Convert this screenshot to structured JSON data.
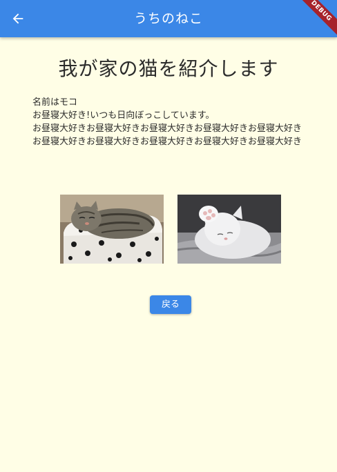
{
  "app_bar": {
    "title": "うちのねこ",
    "back_icon": "arrow-left-icon",
    "debug_label": "DEBUG",
    "color": "#3B87E7"
  },
  "page": {
    "heading": "我が家の猫を紹介します",
    "paragraphs": [
      "名前はモコ",
      "お昼寝大好き!いつも日向ぼっこしています。",
      "お昼寝大好きお昼寝大好きお昼寝大好きお昼寝大好きお昼寝大好きお昼寝大好きお昼寝大好きお昼寝大好きお昼寝大好きお昼寝大好き"
    ],
    "background": "#FFFEE6"
  },
  "photos": [
    {
      "name": "tabby-cat-in-bed-photo"
    },
    {
      "name": "white-cat-sleeping-photo"
    }
  ],
  "buttons": {
    "back_label": "戻る"
  }
}
